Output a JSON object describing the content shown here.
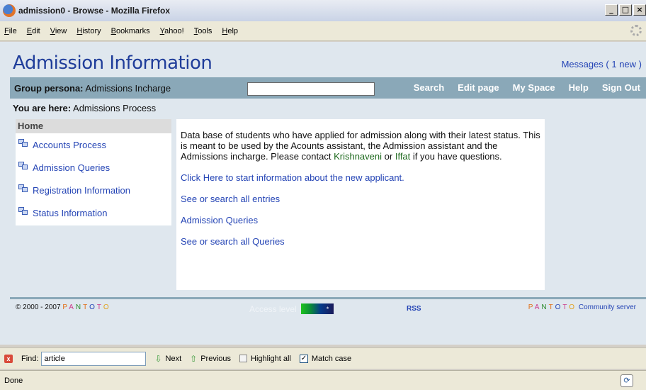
{
  "window": {
    "title": "admission0 - Browse - Mozilla Firefox",
    "controls": [
      "_",
      "□",
      "×"
    ]
  },
  "menu": [
    "File",
    "Edit",
    "View",
    "History",
    "Bookmarks",
    "Yahoo!",
    "Tools",
    "Help"
  ],
  "page": {
    "title": "Admission Information",
    "messages": "Messages ( 1 new )"
  },
  "navbar": {
    "persona_label": "Group persona:",
    "persona_value": "Admissions Incharge",
    "search_value": "",
    "links": [
      "Search",
      "Edit page",
      "My Space",
      "Help",
      "Sign Out"
    ]
  },
  "breadcrumb": {
    "label": "You are here:",
    "value": "Admissions Process"
  },
  "sidebar": {
    "home": "Home",
    "items": [
      "Accounts Process",
      "Admission Queries",
      "Registration Information",
      "Status Information"
    ]
  },
  "main": {
    "intro_text": "Data base of students who have applied for admission along with their latest status. This is meant to be used by the Acounts assistant, the Admission assistant and the Admissions incharge. Please contact",
    "contact1": "Krishnaveni",
    "or_text": "or",
    "contact2": "Iffat",
    "intro_end": "if you have questions.",
    "links": [
      "Click Here to start information about the new applicant.",
      "See or search all entries",
      "Admission Queries",
      "See or search all Queries"
    ]
  },
  "footer": {
    "copyright": "© 2000 - 2007",
    "brand_letters": [
      "P",
      "A",
      "N",
      "T",
      "O",
      "T",
      "O"
    ],
    "access_label": "Access level",
    "access_mark": "*",
    "rss": "RSS",
    "community": "Community server"
  },
  "findbar": {
    "label": "Find:",
    "value": "article",
    "next": "Next",
    "previous": "Previous",
    "highlight": "Highlight all",
    "match_case": "Match case",
    "match_case_checked": true
  },
  "status": {
    "text": "Done"
  },
  "colors": {
    "page_bg": "#dfe7ee",
    "nav_bg": "#8aa8b8",
    "title_blue": "#1f3d9a",
    "link_blue": "#2444b5"
  }
}
